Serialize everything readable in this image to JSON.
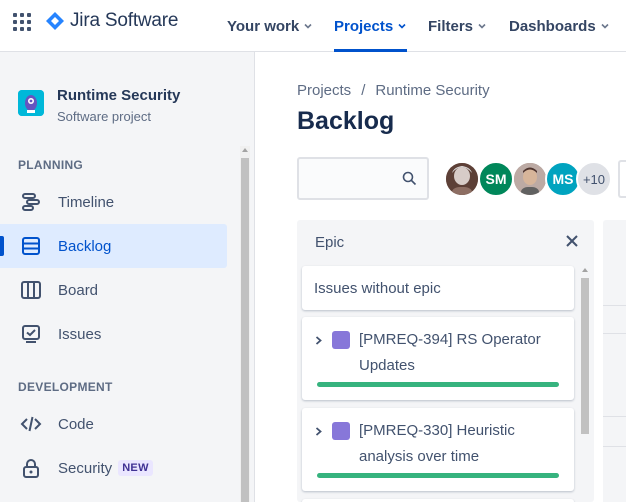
{
  "topnav": {
    "app_name": "Jira Software",
    "items": [
      {
        "label": "Your work",
        "active": false
      },
      {
        "label": "Projects",
        "active": true
      },
      {
        "label": "Filters",
        "active": false
      },
      {
        "label": "Dashboards",
        "active": false
      }
    ],
    "accent_color": "#0052cc"
  },
  "sidebar": {
    "project_name": "Runtime Security",
    "project_type": "Software project",
    "planning_heading": "PLANNING",
    "planning_items": [
      {
        "label": "Timeline",
        "icon": "timeline-icon",
        "active": false
      },
      {
        "label": "Backlog",
        "icon": "backlog-icon",
        "active": true
      },
      {
        "label": "Board",
        "icon": "board-icon",
        "active": false
      },
      {
        "label": "Issues",
        "icon": "issues-icon",
        "active": false
      }
    ],
    "development_heading": "DEVELOPMENT",
    "development_items": [
      {
        "label": "Code",
        "icon": "code-icon"
      },
      {
        "label": "Security",
        "icon": "lock-icon",
        "badge": "NEW"
      }
    ]
  },
  "main": {
    "breadcrumb": [
      "Projects",
      "Runtime Security"
    ],
    "breadcrumb_separator": "/",
    "title": "Backlog",
    "search_placeholder": "",
    "avatars": [
      {
        "initials": "",
        "color": "#8d6e63"
      },
      {
        "initials": "SM",
        "color": "#00875a"
      },
      {
        "initials": "",
        "color": "#a1887f"
      },
      {
        "initials": "MS",
        "color": "#00a3bf"
      }
    ],
    "more_avatars": "+10"
  },
  "epic_panel": {
    "heading": "Epic",
    "no_epic_label": "Issues without epic",
    "epics": [
      {
        "title": "[PMREQ-394] RS Operator Updates",
        "color": "#8777d9",
        "progress": 1.0
      },
      {
        "title": "[PMREQ-330] Heuristic analysis over time",
        "color": "#8777d9",
        "progress": 1.0
      }
    ]
  }
}
